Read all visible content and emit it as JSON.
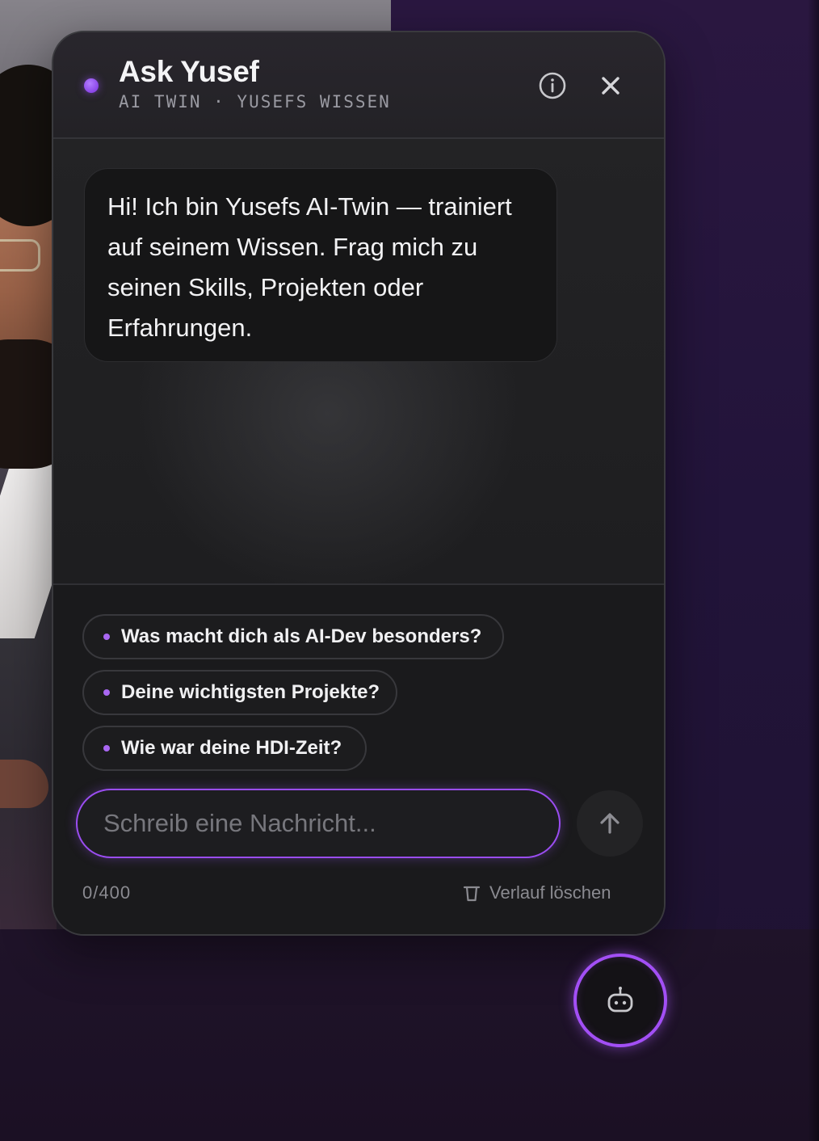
{
  "chat": {
    "title": "Ask Yusef",
    "subtitle": "AI TWIN · YUSEFS WISSEN",
    "greeting": "Hi! Ich bin Yusefs AI-Twin — trainiert auf seinem Wissen. Frag mich zu seinen Skills, Projekten oder Erfahrungen.",
    "suggestions": [
      "Was macht dich als AI-Dev besonders?",
      "Deine wichtigsten Projekte?",
      "Wie war deine HDI-Zeit?"
    ],
    "input": {
      "placeholder": "Schreib eine Nachricht...",
      "value": ""
    },
    "counter": "0/400",
    "clear_label": "Verlauf löschen"
  },
  "icons": {
    "status": "status-dot",
    "info": "info-icon",
    "close": "close-icon",
    "send": "arrow-up-icon",
    "clear": "trash-icon",
    "launcher": "robot-icon"
  },
  "colors": {
    "accent": "#9a4df0",
    "panel_bg": "#1b1b1d",
    "page_bg": "#22143a"
  }
}
